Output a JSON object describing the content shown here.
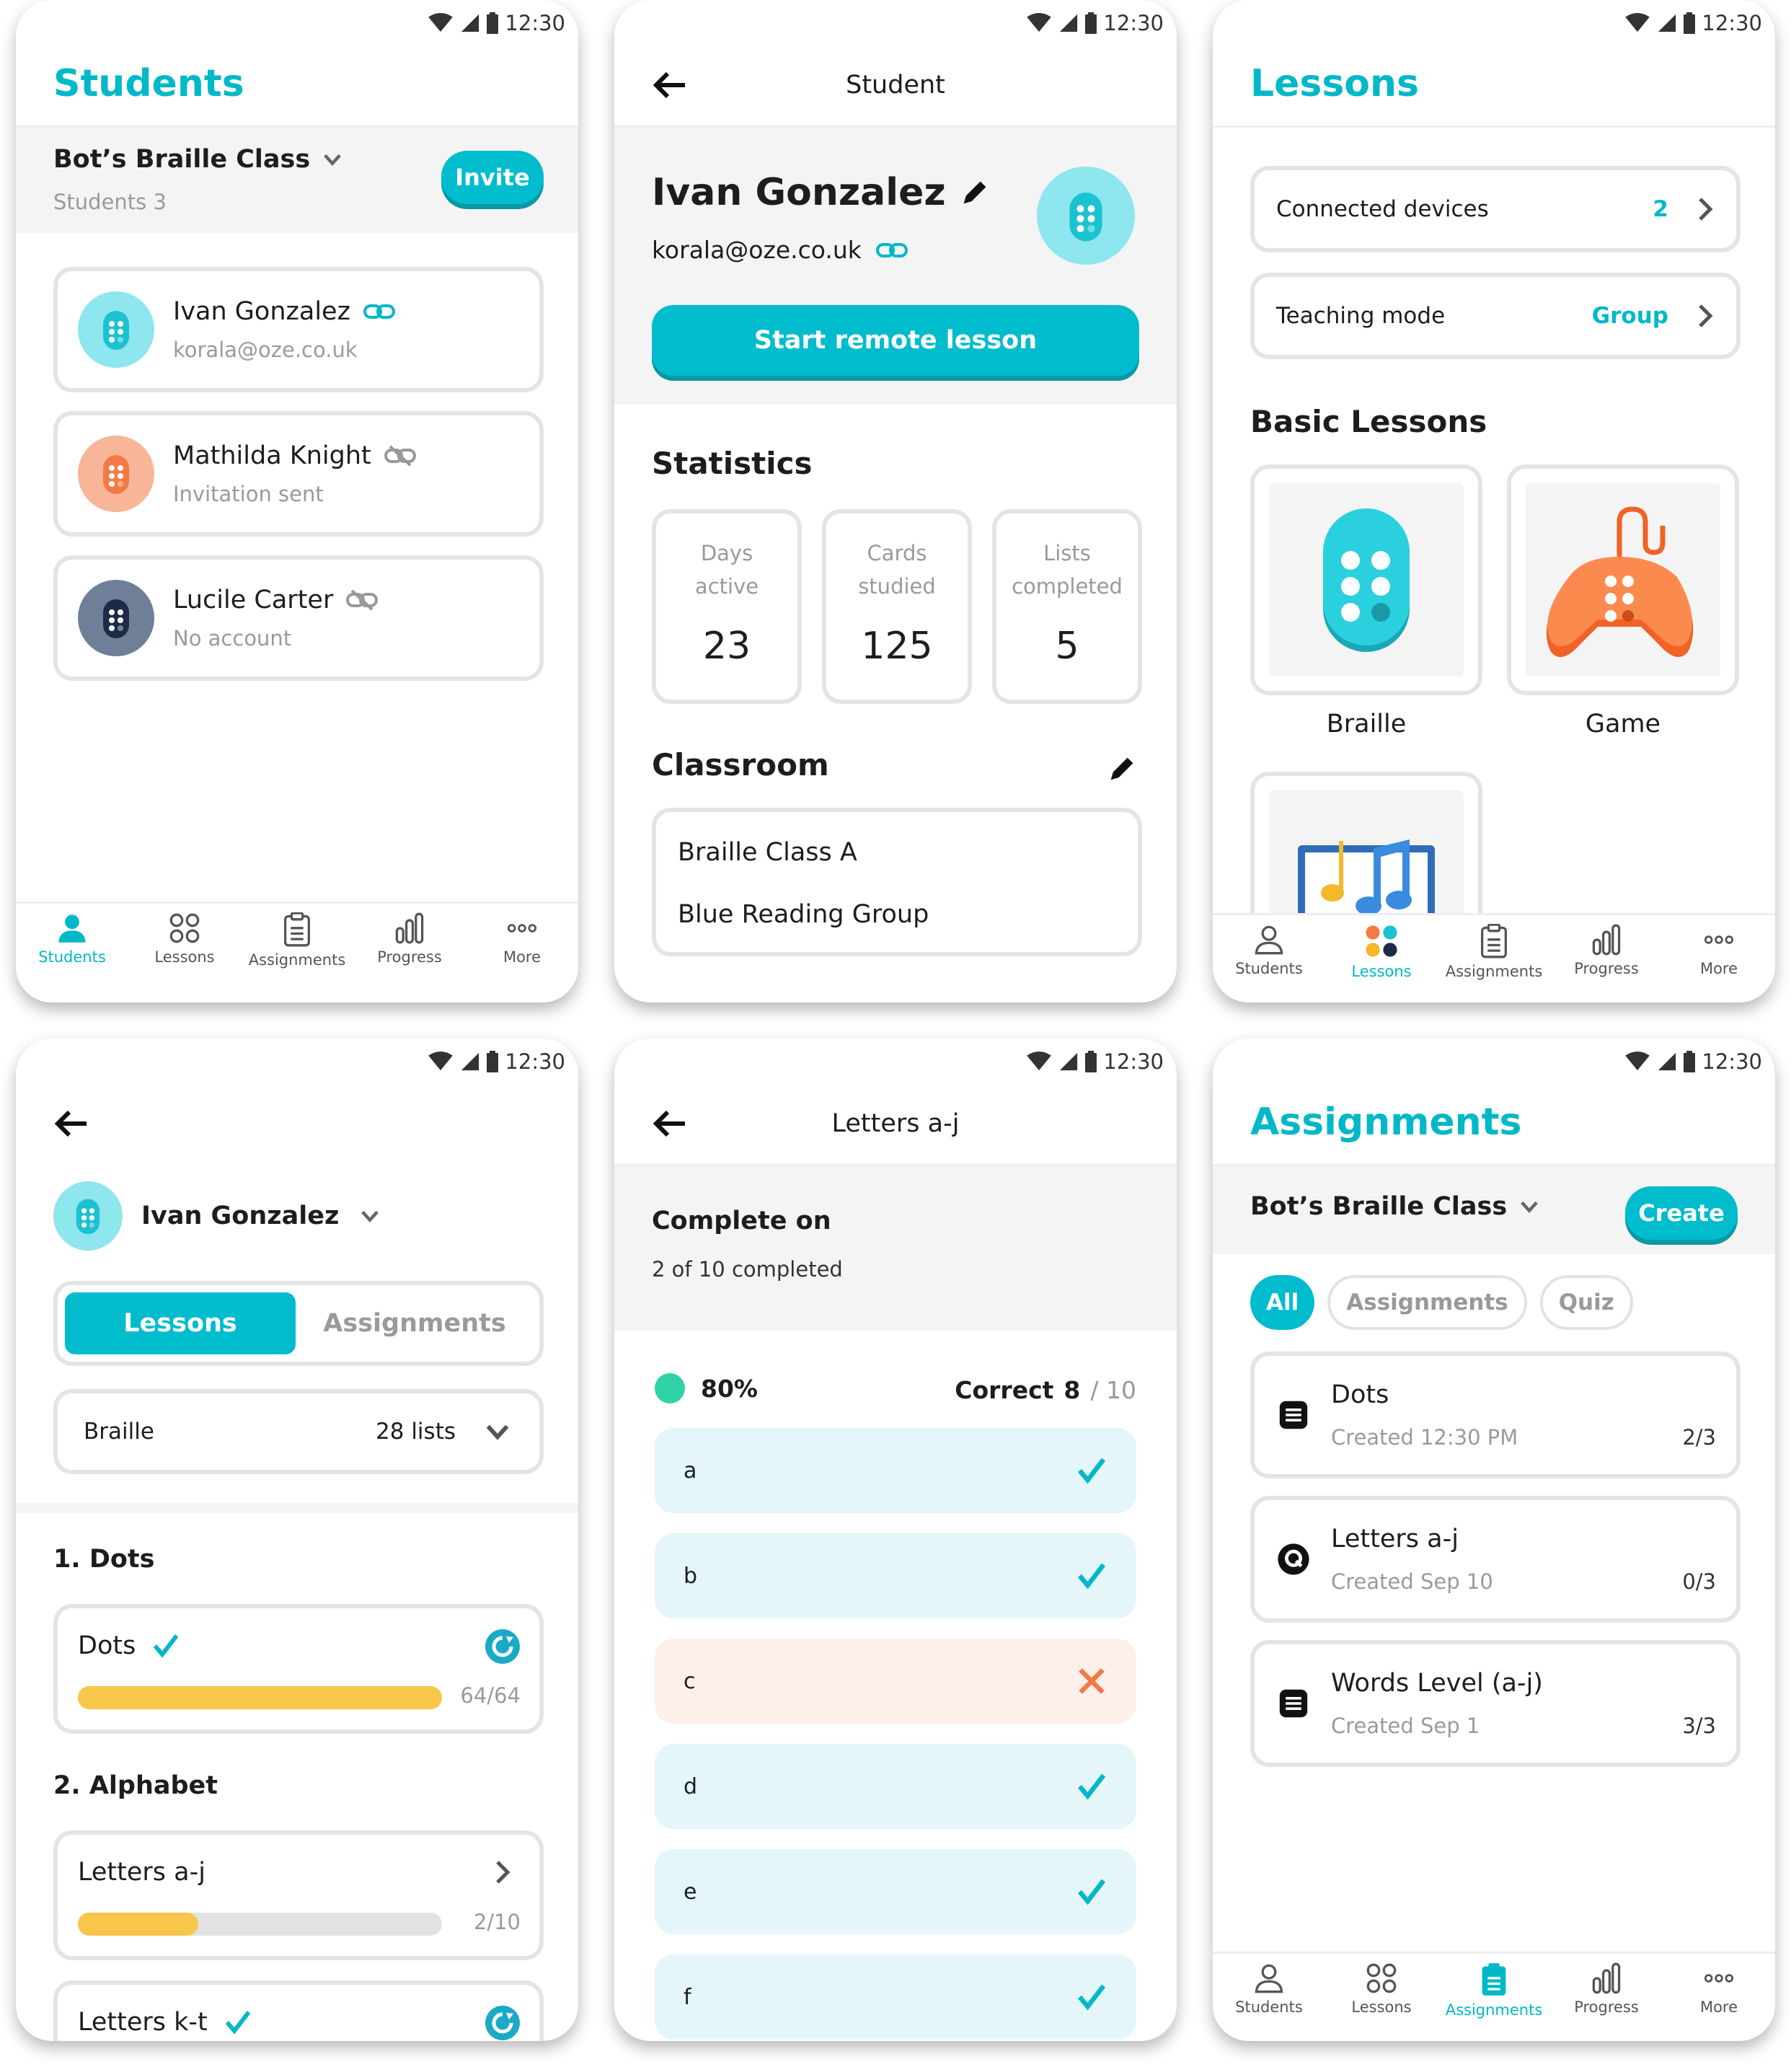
{
  "status": {
    "time": "12:30"
  },
  "nav": {
    "students": "Students",
    "lessons": "Lessons",
    "assignments": "Assignments",
    "progress": "Progress",
    "more": "More"
  },
  "colors": {
    "accent": "#00bccd",
    "orange": "#f47a45",
    "navy": "#2a3a5a",
    "yellow": "#f8c64a"
  },
  "screen1": {
    "title": "Students",
    "class_name": "Bot’s Braille Class",
    "students_count": "Students 3",
    "invite": "Invite",
    "students": [
      {
        "name": "Ivan Gonzalez",
        "sub": "korala@oze.co.uk",
        "icon": "link-icon"
      },
      {
        "name": "Mathilda Knight",
        "sub": "Invitation sent",
        "icon": "unlinked-icon"
      },
      {
        "name": "Lucile Carter",
        "sub": "No account",
        "icon": "unlinked-icon"
      }
    ]
  },
  "screen2": {
    "header": "Student",
    "name": "Ivan Gonzalez",
    "email": "korala@oze.co.uk",
    "start": "Start remote lesson",
    "stats_title": "Statistics",
    "stats": [
      {
        "label1": "Days",
        "label2": "active",
        "value": "23"
      },
      {
        "label1": "Cards",
        "label2": "studied",
        "value": "125"
      },
      {
        "label1": "Lists",
        "label2": "completed",
        "value": "5"
      }
    ],
    "classroom_title": "Classroom",
    "classrooms": [
      "Braille Class A",
      "Blue Reading Group"
    ]
  },
  "screen3": {
    "title": "Lessons",
    "connected_label": "Connected devices",
    "connected_value": "2",
    "mode_label": "Teaching mode",
    "mode_value": "Group",
    "basic_title": "Basic Lessons",
    "tiles": [
      "Braille",
      "Game"
    ]
  },
  "screen4": {
    "student": "Ivan Gonzalez",
    "tab_lessons": "Lessons",
    "tab_assignments": "Assignments",
    "select_label": "Braille",
    "select_value": "28 lists",
    "section1": "1. Dots",
    "section2": "2. Alphabet",
    "items": [
      {
        "name": "Dots",
        "count": "64/64",
        "progress": 1.0
      },
      {
        "name": "Letters a-j",
        "count": "2/10",
        "progress": 0.33
      },
      {
        "name": "Letters k-t",
        "count": "",
        "progress": 1.0
      }
    ]
  },
  "screen5": {
    "header": "Letters a-j",
    "complete_title": "Complete on",
    "complete_sub": "2 of 10 completed",
    "percent": "80%",
    "correct_label": "Correct",
    "correct_value": "8",
    "correct_total": "/ 10",
    "answers": [
      {
        "letter": "a",
        "ok": true
      },
      {
        "letter": "b",
        "ok": true
      },
      {
        "letter": "c",
        "ok": false
      },
      {
        "letter": "d",
        "ok": true
      },
      {
        "letter": "e",
        "ok": true
      },
      {
        "letter": "f",
        "ok": true
      }
    ]
  },
  "screen6": {
    "title": "Assignments",
    "class_name": "Bot’s Braille Class",
    "create": "Create",
    "filters": [
      "All",
      "Assignments",
      "Quiz"
    ],
    "items": [
      {
        "name": "Dots",
        "created": "Created 12:30 PM",
        "count": "2/3",
        "icon": "list-icon"
      },
      {
        "name": "Letters a-j",
        "created": "Created Sep 10",
        "count": "0/3",
        "icon": "quiz-icon"
      },
      {
        "name": "Words Level (a-j)",
        "created": "Created Sep 1",
        "count": "3/3",
        "icon": "list-icon"
      }
    ]
  }
}
